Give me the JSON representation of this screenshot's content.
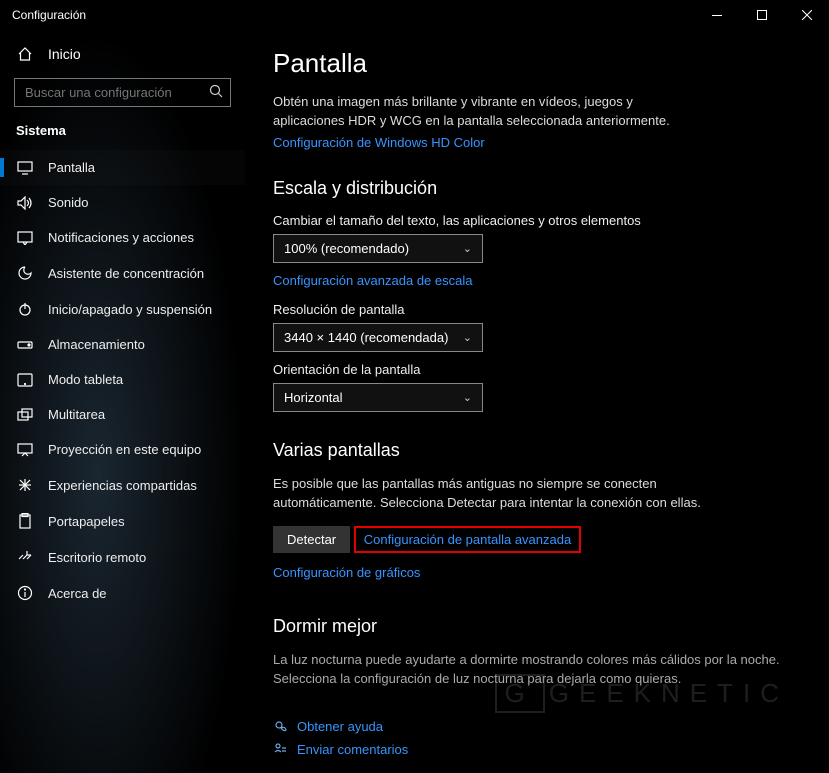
{
  "window": {
    "title": "Configuración"
  },
  "sidebar": {
    "home": "Inicio",
    "search_placeholder": "Buscar una configuración",
    "category": "Sistema",
    "items": [
      {
        "label": "Pantalla",
        "icon": "display-icon",
        "active": true
      },
      {
        "label": "Sonido",
        "icon": "sound-icon"
      },
      {
        "label": "Notificaciones y acciones",
        "icon": "notifications-icon"
      },
      {
        "label": "Asistente de concentración",
        "icon": "focus-icon"
      },
      {
        "label": "Inicio/apagado y suspensión",
        "icon": "power-icon"
      },
      {
        "label": "Almacenamiento",
        "icon": "storage-icon"
      },
      {
        "label": "Modo tableta",
        "icon": "tablet-icon"
      },
      {
        "label": "Multitarea",
        "icon": "multitask-icon"
      },
      {
        "label": "Proyección en este equipo",
        "icon": "projection-icon"
      },
      {
        "label": "Experiencias compartidas",
        "icon": "shared-icon"
      },
      {
        "label": "Portapapeles",
        "icon": "clipboard-icon"
      },
      {
        "label": "Escritorio remoto",
        "icon": "remote-icon"
      },
      {
        "label": "Acerca de",
        "icon": "about-icon"
      }
    ]
  },
  "main": {
    "title": "Pantalla",
    "hd_desc": "Obtén una imagen más brillante y vibrante en vídeos, juegos y aplicaciones HDR y WCG en la pantalla seleccionada anteriormente.",
    "hd_link": "Configuración de Windows HD Color",
    "scale_h": "Escala y distribución",
    "scale_label": "Cambiar el tamaño del texto, las aplicaciones y otros elementos",
    "scale_value": "100% (recomendado)",
    "scale_link": "Configuración avanzada de escala",
    "res_label": "Resolución de pantalla",
    "res_value": "3440 × 1440 (recomendada)",
    "orient_label": "Orientación de la pantalla",
    "orient_value": "Horizontal",
    "multi_h": "Varias pantallas",
    "multi_desc": "Es posible que las pantallas más antiguas no siempre se conecten automáticamente. Selecciona Detectar para intentar la conexión con ellas.",
    "detect_btn": "Detectar",
    "adv_display_link": "Configuración de pantalla avanzada",
    "graphics_link": "Configuración de gráficos",
    "sleep_h": "Dormir mejor",
    "sleep_desc": "La luz nocturna puede ayudarte a dormirte mostrando colores más cálidos por la noche. Selecciona la configuración de luz nocturna para dejarla como quieras.",
    "help_link": "Obtener ayuda",
    "feedback_link": "Enviar comentarios"
  },
  "watermark": "GEEKNETIC"
}
